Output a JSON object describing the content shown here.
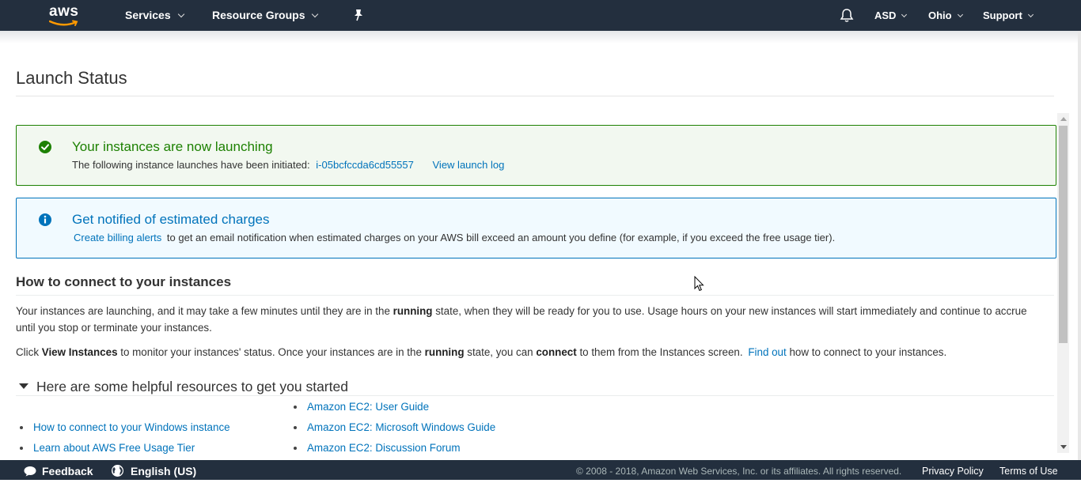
{
  "nav": {
    "logo_text": "aws",
    "services": "Services",
    "resource_groups": "Resource Groups",
    "account": "ASD",
    "region": "Ohio",
    "support": "Support",
    "brand_color": "#232f3e"
  },
  "page": {
    "title": "Launch Status"
  },
  "success_alert": {
    "title": "Your instances are now launching",
    "body": "The following instance launches have been initiated:",
    "instance_id": "i-05bcfccda6cd55557",
    "log_link": "View launch log",
    "color": "#1d8102"
  },
  "info_alert": {
    "title": "Get notified of estimated charges",
    "link": "Create billing alerts",
    "body": "to get an email notification when estimated charges on your AWS bill exceed an amount you define (for example, if you exceed the free usage tier).",
    "color": "#0073bb"
  },
  "connect": {
    "heading": "How to connect to your instances",
    "p1_a": "Your instances are launching, and it may take a few minutes until they are in the",
    "p1_b": "running",
    "p1_c": "state, when they will be ready for you to use. Usage hours on your new instances will start immediately and continue to accrue until you stop or terminate your instances.",
    "p2_a": "Click",
    "p2_b": "View Instances",
    "p2_c": "to monitor your instances' status. Once your instances are in the",
    "p2_d": "running",
    "p2_e": "state, you can",
    "p2_f": "connect",
    "p2_g": "to them from the Instances screen.",
    "p2_link": "Find out",
    "p2_h": "how to connect to your instances."
  },
  "resources": {
    "heading": "Here are some helpful resources to get you started",
    "left": [
      "How to connect to your Windows instance",
      "Learn about AWS Free Usage Tier"
    ],
    "right": [
      "Amazon EC2: User Guide",
      "Amazon EC2: Microsoft Windows Guide",
      "Amazon EC2: Discussion Forum"
    ]
  },
  "footer": {
    "feedback": "Feedback",
    "language": "English (US)",
    "copyright": "© 2008 - 2018, Amazon Web Services, Inc. or its affiliates. All rights reserved.",
    "privacy": "Privacy Policy",
    "terms": "Terms of Use"
  }
}
